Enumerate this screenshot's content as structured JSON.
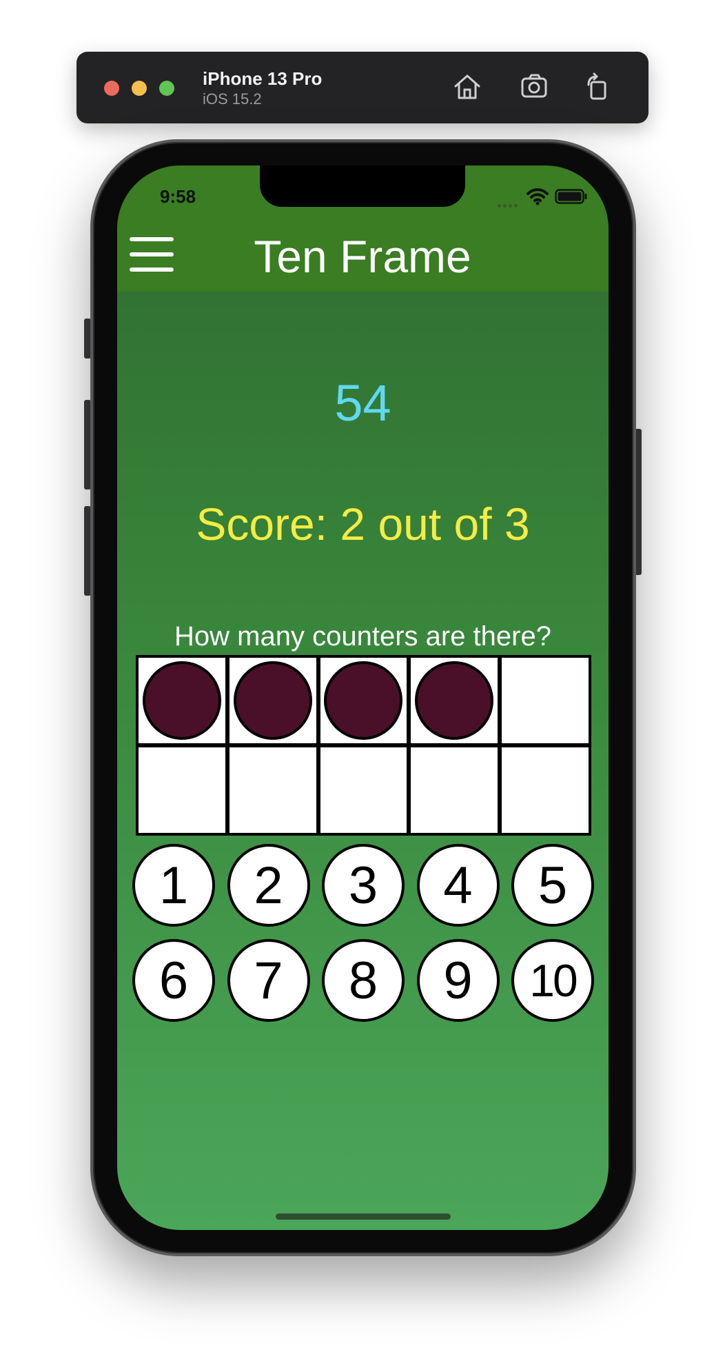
{
  "simulator": {
    "device_name": "iPhone 13 Pro",
    "os_version": "iOS 15.2",
    "icons": [
      "home-icon",
      "screenshot-icon",
      "rotate-icon"
    ]
  },
  "status_bar": {
    "time": "9:58",
    "icons": [
      "wifi-icon",
      "battery-icon"
    ]
  },
  "nav": {
    "title": "Ten Frame",
    "menu_icon": "hamburger-menu-icon"
  },
  "game": {
    "number": "54",
    "score": "Score: 2 out of 3",
    "question": "How many counters are there?",
    "frame_cells": [
      true,
      true,
      true,
      true,
      false,
      false,
      false,
      false,
      false,
      false
    ],
    "answers": [
      "1",
      "2",
      "3",
      "4",
      "5",
      "6",
      "7",
      "8",
      "9",
      "10"
    ]
  },
  "colors": {
    "nav_bar": "#3a7d22",
    "number_text": "#62d8f0",
    "score_text": "#f5ec45",
    "counter": "#4a1029"
  }
}
